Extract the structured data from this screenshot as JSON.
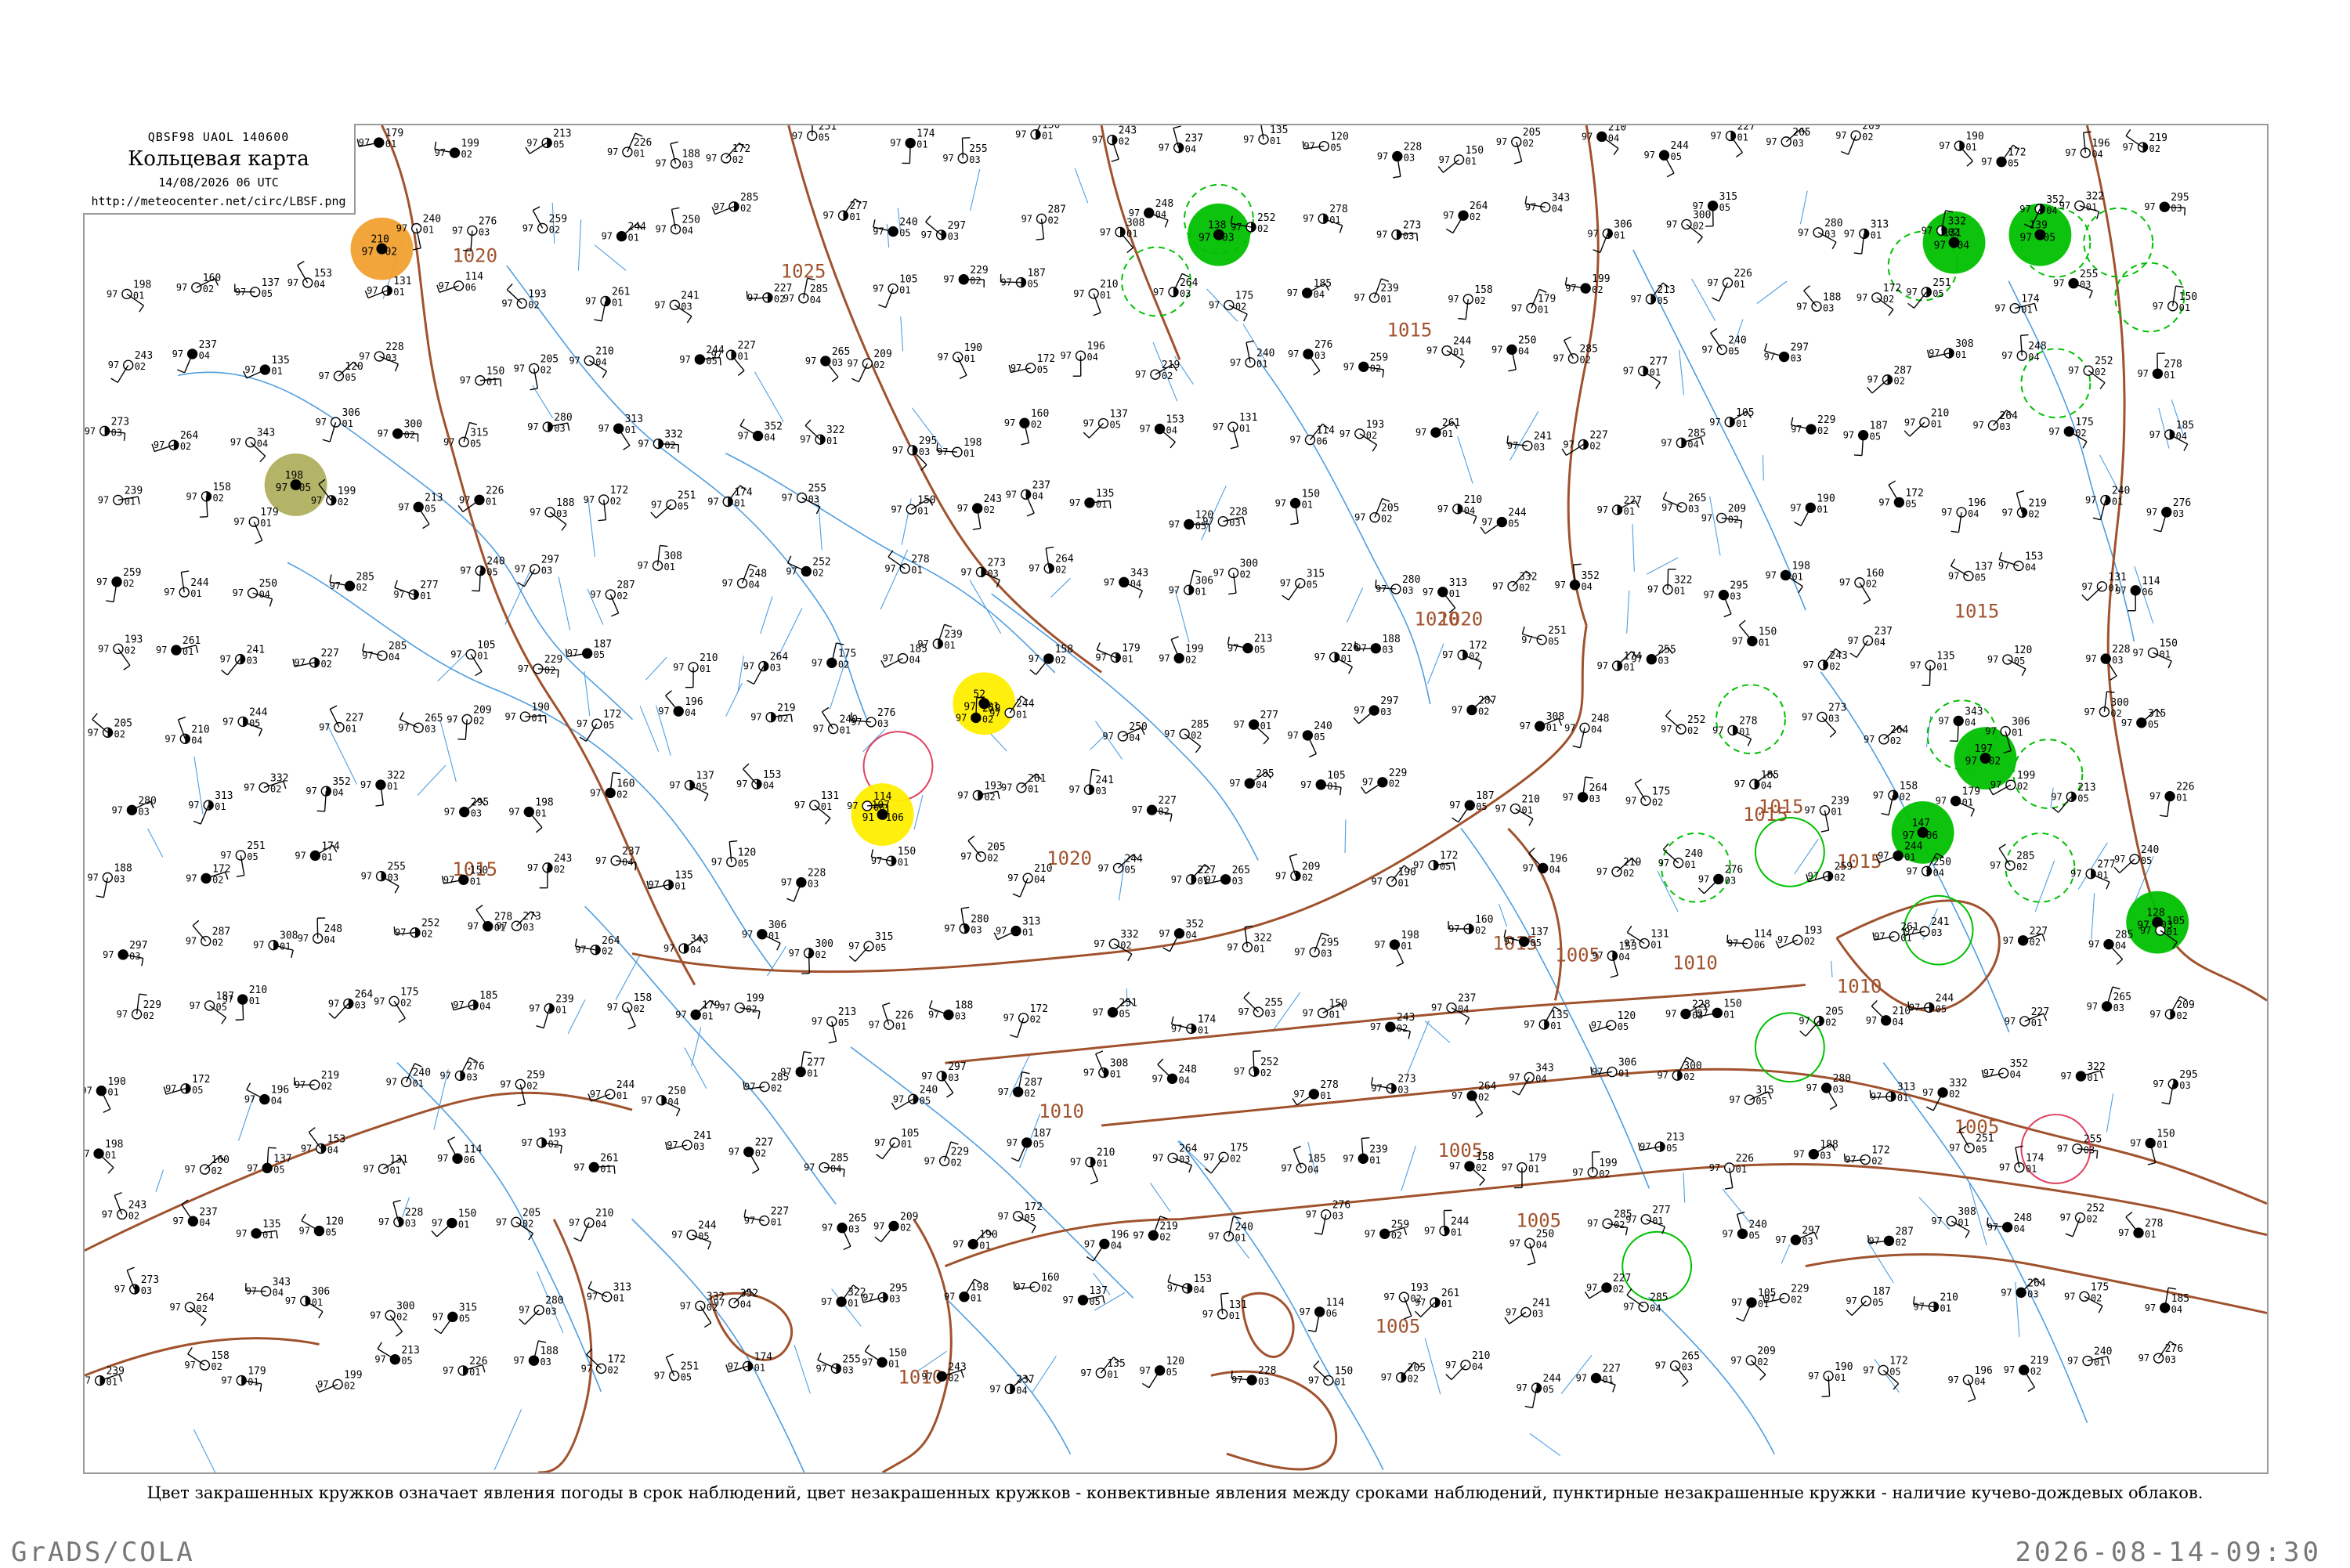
{
  "header": {
    "code": "QBSF98  UAOL  140600",
    "title": "Кольцевая карта",
    "time": "14/08/2026 06 UTC",
    "url": "http://meteocenter.net/circ/LBSF.png"
  },
  "caption": "Цвет закрашенных кружков означает явления погоды в срок наблюдений, цвет незакрашенных кружков - конвективные явления между сроками наблюдений, пунктирные незакрашенные кружки - наличие кучево-дождевых облаков.",
  "footer": {
    "software": "GrADS/COLA",
    "timestamp": "2026-08-14-09:30"
  },
  "colors": {
    "isobar": "#a0522d",
    "river": "#4f9ee0",
    "frame": "#9a9a9a",
    "rain": "#00c000",
    "fog": "#ffee00",
    "haze": "#f0a030",
    "dust": "#b0b060",
    "thunder_past": "#e04060"
  },
  "isobar_labels": [
    "1020",
    "1025",
    "1020",
    "1015",
    "1020",
    "1015",
    "1015",
    "1020",
    "1015",
    "1015",
    "1010",
    "1005",
    "1010",
    "1005",
    "1010",
    "1005",
    "1015",
    "1015",
    "1010",
    "1005",
    "1005"
  ],
  "stations": [
    {
      "p": "179",
      "t": "97",
      "d": "01"
    },
    {
      "p": "199",
      "t": "97",
      "d": "02"
    },
    {
      "p": "213",
      "t": "97",
      "d": "05"
    },
    {
      "p": "226",
      "t": "97",
      "d": "01"
    },
    {
      "p": "188",
      "t": "97",
      "d": "03"
    },
    {
      "p": "172",
      "t": "97",
      "d": "02"
    },
    {
      "p": "251",
      "t": "97",
      "d": "05"
    },
    {
      "p": "174",
      "t": "97",
      "d": "01"
    },
    {
      "p": "255",
      "t": "97",
      "d": "03"
    },
    {
      "p": "150",
      "t": "97",
      "d": "01"
    },
    {
      "p": "243",
      "t": "97",
      "d": "02"
    },
    {
      "p": "237",
      "t": "97",
      "d": "04"
    },
    {
      "p": "135",
      "t": "97",
      "d": "01"
    },
    {
      "p": "120",
      "t": "97",
      "d": "05"
    },
    {
      "p": "228",
      "t": "97",
      "d": "03"
    },
    {
      "p": "150",
      "t": "97",
      "d": "01"
    },
    {
      "p": "205",
      "t": "97",
      "d": "02"
    },
    {
      "p": "210",
      "t": "97",
      "d": "04"
    },
    {
      "p": "244",
      "t": "97",
      "d": "05"
    },
    {
      "p": "227",
      "t": "97",
      "d": "01"
    },
    {
      "p": "265",
      "t": "97",
      "d": "03"
    },
    {
      "p": "209",
      "t": "97",
      "d": "02"
    },
    {
      "p": "190",
      "t": "97",
      "d": "01"
    },
    {
      "p": "172",
      "t": "97",
      "d": "05"
    },
    {
      "p": "196",
      "t": "97",
      "d": "04"
    },
    {
      "p": "219",
      "t": "97",
      "d": "02"
    },
    {
      "p": "240",
      "t": "97",
      "d": "01"
    },
    {
      "p": "276",
      "t": "97",
      "d": "03"
    },
    {
      "p": "259",
      "t": "97",
      "d": "02"
    },
    {
      "p": "244",
      "t": "97",
      "d": "01"
    },
    {
      "p": "250",
      "t": "97",
      "d": "04"
    },
    {
      "p": "285",
      "t": "97",
      "d": "02"
    },
    {
      "p": "277",
      "t": "97",
      "d": "01"
    },
    {
      "p": "240",
      "t": "97",
      "d": "05"
    },
    {
      "p": "297",
      "t": "97",
      "d": "03"
    },
    {
      "p": "287",
      "t": "97",
      "d": "02"
    },
    {
      "p": "308",
      "t": "97",
      "d": "01"
    },
    {
      "p": "248",
      "t": "97",
      "d": "04"
    },
    {
      "p": "252",
      "t": "97",
      "d": "02"
    },
    {
      "p": "278",
      "t": "97",
      "d": "01"
    },
    {
      "p": "273",
      "t": "97",
      "d": "03"
    },
    {
      "p": "264",
      "t": "97",
      "d": "02"
    },
    {
      "p": "343",
      "t": "97",
      "d": "04"
    },
    {
      "p": "306",
      "t": "97",
      "d": "01"
    },
    {
      "p": "300",
      "t": "97",
      "d": "02"
    },
    {
      "p": "315",
      "t": "97",
      "d": "05"
    },
    {
      "p": "280",
      "t": "97",
      "d": "03"
    },
    {
      "p": "313",
      "t": "97",
      "d": "01"
    },
    {
      "p": "332",
      "t": "97",
      "d": "02"
    },
    {
      "p": "352",
      "t": "97",
      "d": "04"
    },
    {
      "p": "322",
      "t": "97",
      "d": "01"
    },
    {
      "p": "295",
      "t": "97",
      "d": "03"
    },
    {
      "p": "198",
      "t": "97",
      "d": "01"
    },
    {
      "p": "160",
      "t": "97",
      "d": "02"
    },
    {
      "p": "137",
      "t": "97",
      "d": "05"
    },
    {
      "p": "153",
      "t": "97",
      "d": "04"
    },
    {
      "p": "131",
      "t": "97",
      "d": "01"
    },
    {
      "p": "114",
      "t": "97",
      "d": "06"
    },
    {
      "p": "193",
      "t": "97",
      "d": "02"
    },
    {
      "p": "261",
      "t": "97",
      "d": "01"
    },
    {
      "p": "241",
      "t": "97",
      "d": "03"
    },
    {
      "p": "227",
      "t": "97",
      "d": "02"
    },
    {
      "p": "285",
      "t": "97",
      "d": "04"
    },
    {
      "p": "105",
      "t": "97",
      "d": "01"
    },
    {
      "p": "229",
      "t": "97",
      "d": "02"
    },
    {
      "p": "187",
      "t": "97",
      "d": "05"
    },
    {
      "p": "210",
      "t": "97",
      "d": "01"
    },
    {
      "p": "264",
      "t": "97",
      "d": "03"
    },
    {
      "p": "175",
      "t": "97",
      "d": "02"
    },
    {
      "p": "185",
      "t": "97",
      "d": "04"
    },
    {
      "p": "239",
      "t": "97",
      "d": "01"
    },
    {
      "p": "158",
      "t": "97",
      "d": "02"
    }
  ],
  "weather_circles": [
    {
      "kind": "rain",
      "p": "138",
      "t": "97",
      "d": "03"
    },
    {
      "kind": "rain",
      "p": "131",
      "t": "97",
      "d": "04"
    },
    {
      "kind": "rain",
      "p": "139",
      "t": "97",
      "d": "05"
    },
    {
      "kind": "rain",
      "p": "197",
      "t": "97",
      "d": "02"
    },
    {
      "kind": "rain",
      "p": "147",
      "t": "97",
      "d": "06"
    },
    {
      "kind": "rain",
      "p": "128",
      "t": "97",
      "d": "03"
    },
    {
      "kind": "fog",
      "p": "52",
      "t": "97",
      "d": "01"
    },
    {
      "kind": "fog",
      "p": "107",
      "t": "91",
      "d": "106"
    },
    {
      "kind": "haze",
      "p": "210",
      "t": "97",
      "d": "02"
    },
    {
      "kind": "dust",
      "p": "198",
      "t": "97",
      "d": "05"
    }
  ],
  "conv_rings": [
    {
      "kind": "dashed"
    },
    {
      "kind": "dashed"
    },
    {
      "kind": "dashed"
    },
    {
      "kind": "dashed"
    },
    {
      "kind": "dashed"
    },
    {
      "kind": "dashed"
    },
    {
      "kind": "dashed"
    },
    {
      "kind": "dashed"
    },
    {
      "kind": "dashed"
    },
    {
      "kind": "dashed"
    },
    {
      "kind": "dashed"
    },
    {
      "kind": "dashed"
    },
    {
      "kind": "solid-green"
    },
    {
      "kind": "solid-green"
    },
    {
      "kind": "solid-green"
    },
    {
      "kind": "solid-green"
    },
    {
      "kind": "solid-red"
    },
    {
      "kind": "solid-red"
    }
  ]
}
